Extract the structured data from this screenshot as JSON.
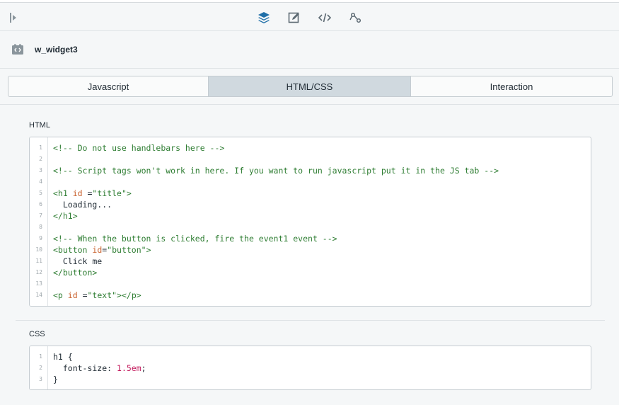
{
  "toolbar": {
    "icons": [
      "collapse-icon",
      "layers-icon",
      "edit-icon",
      "code-icon",
      "flow-icon"
    ],
    "active_icon": "layers-icon",
    "accent": "#1f6fa8"
  },
  "widget": {
    "name": "w_widget3",
    "icon": "widget-icon"
  },
  "tabs": [
    {
      "label": "Javascript",
      "active": false
    },
    {
      "label": "HTML/CSS",
      "active": true
    },
    {
      "label": "Interaction",
      "active": false
    }
  ],
  "html_section": {
    "label": "HTML",
    "lines": [
      {
        "n": "1",
        "tokens": [
          [
            "c",
            "<!-- Do not use handlebars here -->"
          ]
        ]
      },
      {
        "n": "2",
        "tokens": []
      },
      {
        "n": "3",
        "tokens": [
          [
            "c",
            "<!-- Script tags won't work in here. If you want to run javascript put it in the JS tab -->"
          ]
        ]
      },
      {
        "n": "4",
        "tokens": []
      },
      {
        "n": "5",
        "tokens": [
          [
            "t",
            "<h1 "
          ],
          [
            "a",
            "id"
          ],
          [
            "p",
            " ="
          ],
          [
            "s",
            "\"title\""
          ],
          [
            "t",
            ">"
          ]
        ]
      },
      {
        "n": "6",
        "tokens": [
          [
            "p",
            "  Loading..."
          ]
        ]
      },
      {
        "n": "7",
        "tokens": [
          [
            "t",
            "</h1>"
          ]
        ]
      },
      {
        "n": "8",
        "tokens": []
      },
      {
        "n": "9",
        "tokens": [
          [
            "c",
            "<!-- When the button is clicked, fire the event1 event -->"
          ]
        ]
      },
      {
        "n": "10",
        "tokens": [
          [
            "t",
            "<button "
          ],
          [
            "a",
            "id"
          ],
          [
            "p",
            "="
          ],
          [
            "s",
            "\"button\""
          ],
          [
            "t",
            ">"
          ]
        ]
      },
      {
        "n": "11",
        "tokens": [
          [
            "p",
            "  Click me"
          ]
        ]
      },
      {
        "n": "12",
        "tokens": [
          [
            "t",
            "</button>"
          ]
        ]
      },
      {
        "n": "13",
        "tokens": []
      },
      {
        "n": "14",
        "tokens": [
          [
            "t",
            "<p "
          ],
          [
            "a",
            "id"
          ],
          [
            "p",
            " ="
          ],
          [
            "s",
            "\"text\""
          ],
          [
            "t",
            "></p>"
          ]
        ]
      }
    ]
  },
  "css_section": {
    "label": "CSS",
    "lines": [
      {
        "n": "1",
        "tokens": [
          [
            "p",
            "h1 {"
          ]
        ]
      },
      {
        "n": "2",
        "tokens": [
          [
            "p",
            "  font-size: "
          ],
          [
            "num",
            "1.5em"
          ],
          [
            "p",
            ";"
          ]
        ]
      },
      {
        "n": "3",
        "tokens": [
          [
            "p",
            "}"
          ]
        ]
      }
    ]
  }
}
